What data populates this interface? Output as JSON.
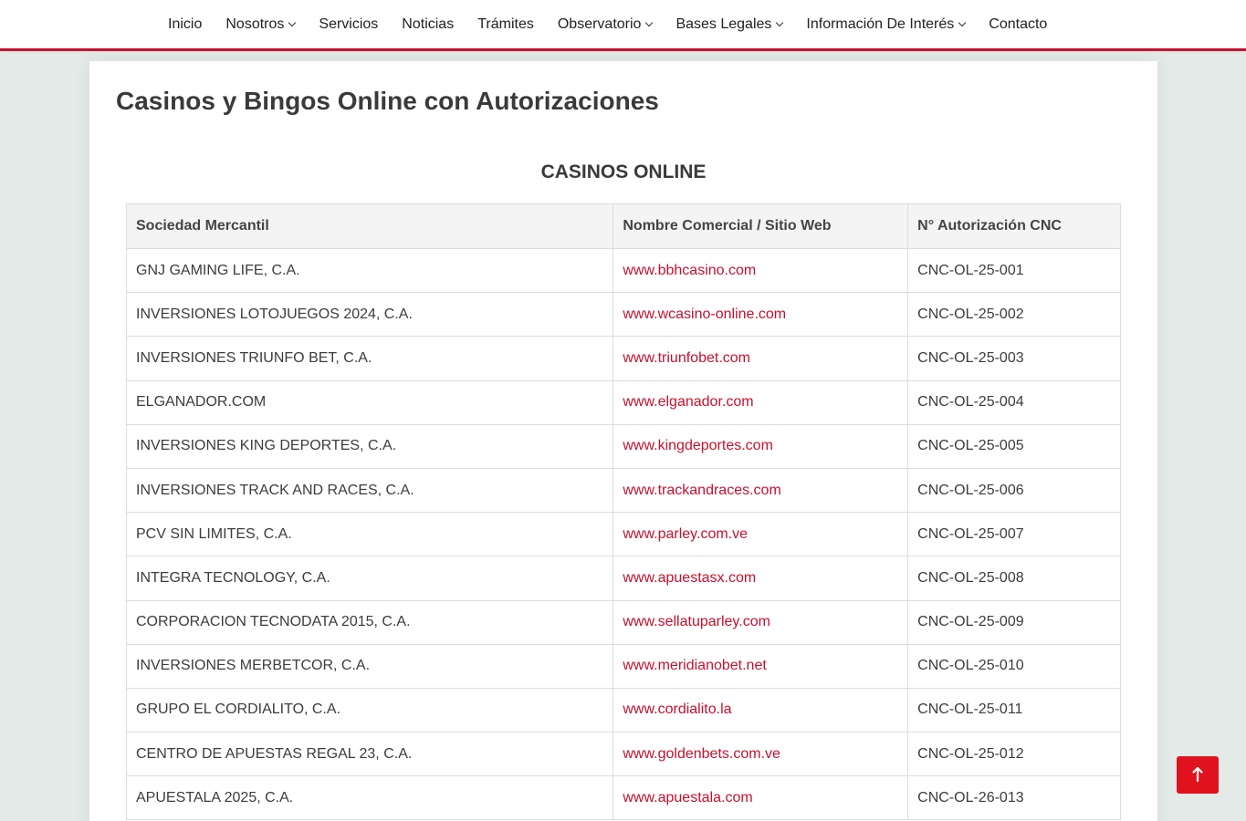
{
  "nav": {
    "items": [
      {
        "label": "Inicio",
        "dropdown": false
      },
      {
        "label": "Nosotros",
        "dropdown": true
      },
      {
        "label": "Servicios",
        "dropdown": false
      },
      {
        "label": "Noticias",
        "dropdown": false
      },
      {
        "label": "Trámites",
        "dropdown": false
      },
      {
        "label": "Observatorio",
        "dropdown": true
      },
      {
        "label": "Bases Legales",
        "dropdown": true
      },
      {
        "label": "Información De Interés",
        "dropdown": true
      },
      {
        "label": "Contacto",
        "dropdown": false
      }
    ]
  },
  "page": {
    "title": "Casinos y Bingos Online con Autorizaciones",
    "section_title": "CASINOS ONLINE"
  },
  "table": {
    "headers": [
      "Sociedad Mercantil",
      "Nombre Comercial / Sitio Web",
      "N° Autorización CNC"
    ],
    "rows": [
      [
        "GNJ GAMING LIFE, C.A.",
        "www.bbhcasino.com",
        "CNC-OL-25-001"
      ],
      [
        "INVERSIONES LOTOJUEGOS 2024, C.A.",
        "www.wcasino-online.com",
        "CNC-OL-25-002"
      ],
      [
        "INVERSIONES TRIUNFO BET, C.A.",
        "www.triunfobet.com",
        "CNC-OL-25-003"
      ],
      [
        "ELGANADOR.COM",
        "www.elganador.com",
        "CNC-OL-25-004"
      ],
      [
        "INVERSIONES KING DEPORTES, C.A.",
        "www.kingdeportes.com",
        "CNC-OL-25-005"
      ],
      [
        "INVERSIONES TRACK AND RACES, C.A.",
        "www.trackandraces.com",
        "CNC-OL-25-006"
      ],
      [
        "PCV SIN LIMITES, C.A.",
        "www.parley.com.ve",
        "CNC-OL-25-007"
      ],
      [
        "INTEGRA TECNOLOGY, C.A.",
        "www.apuestasx.com",
        "CNC-OL-25-008"
      ],
      [
        "CORPORACION TECNODATA 2015, C.A.",
        "www.sellatuparley.com",
        "CNC-OL-25-009"
      ],
      [
        "INVERSIONES MERBETCOR, C.A.",
        "www.meridianobet.net",
        "CNC-OL-25-010"
      ],
      [
        "GRUPO EL CORDIALITO, C.A.",
        "www.cordialito.la",
        "CNC-OL-25-011"
      ],
      [
        "CENTRO DE APUESTAS REGAL 23, C.A.",
        "www.goldenbets.com.ve",
        "CNC-OL-25-012"
      ],
      [
        "APUESTALA 2025, C.A.",
        "www.apuestala.com",
        "CNC-OL-26-013"
      ]
    ]
  },
  "scroll_top": {
    "icon": "arrow-up-icon"
  },
  "colors": {
    "accent": "#c8102e",
    "background": "#e3eae8",
    "header_row": "#f4f4f4"
  }
}
